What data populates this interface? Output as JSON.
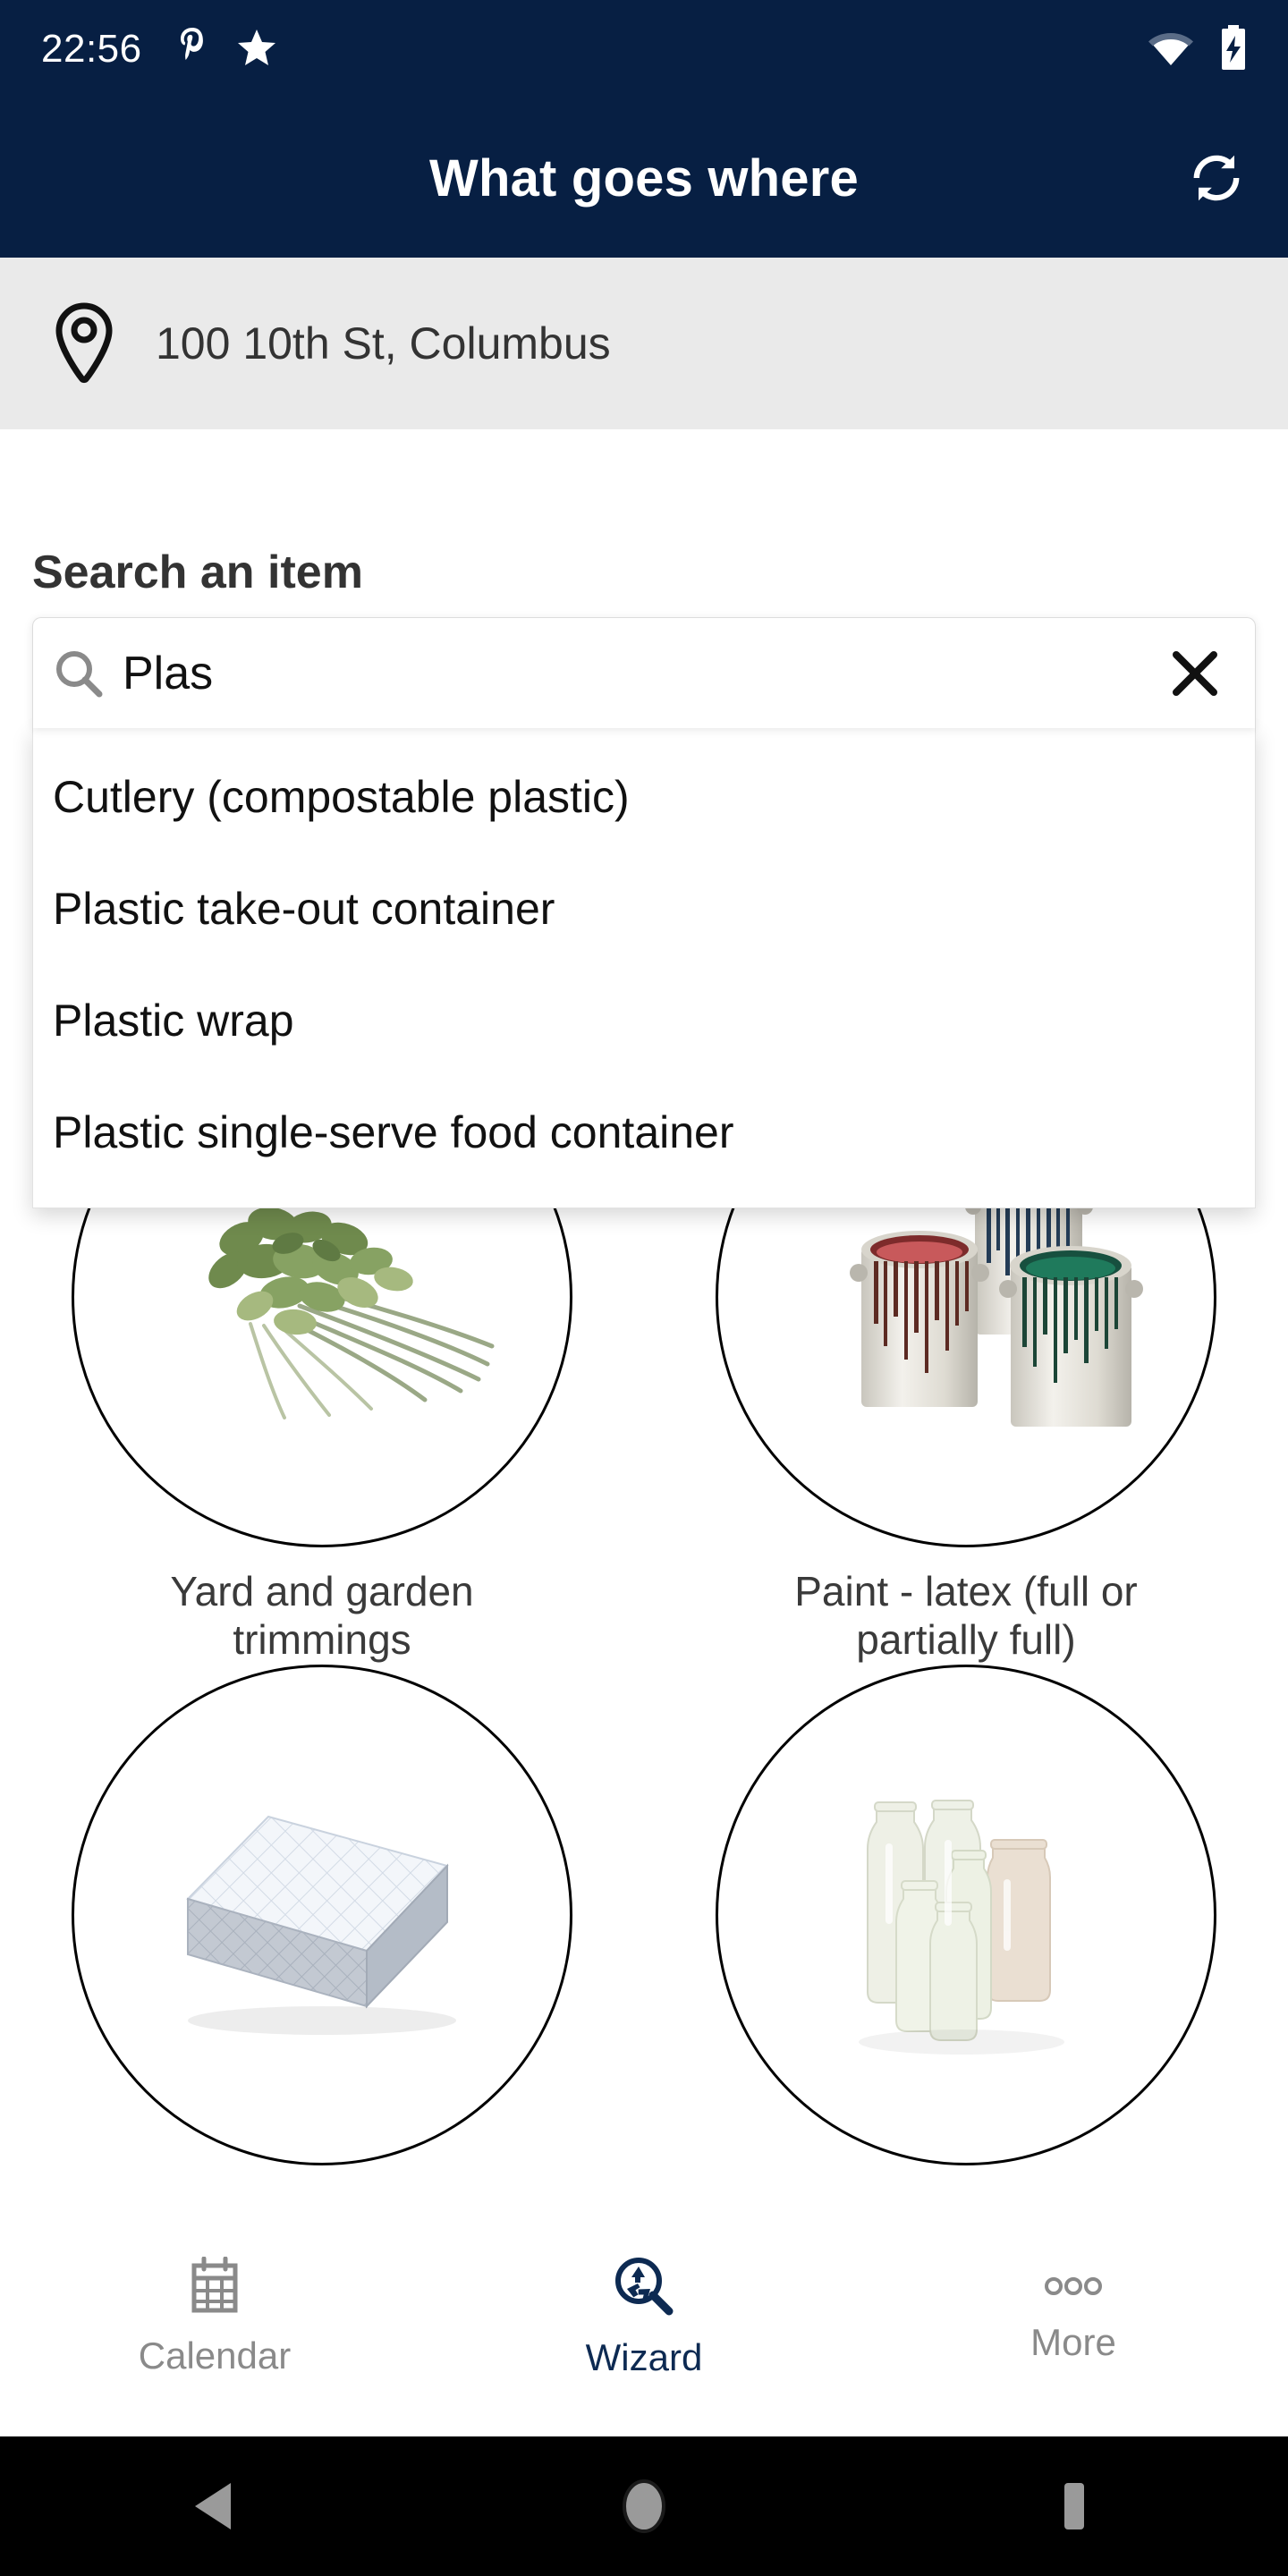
{
  "status_bar": {
    "time": "22:56",
    "left_icons": [
      "pinterest-p-icon",
      "star-icon"
    ],
    "right_icons": [
      "wifi-icon",
      "battery-charging-icon"
    ]
  },
  "app_bar": {
    "title": "What goes where",
    "action_icon": "refresh-sync-icon",
    "background_color": "#071f43",
    "title_color": "#ffffff"
  },
  "location_bar": {
    "icon": "location-pin-icon",
    "address": "100 10th St, Columbus",
    "background_color": "#eaeaea"
  },
  "search": {
    "label": "Search an item",
    "value": "Plas",
    "placeholder": "Search an item",
    "search_icon": "magnifier-icon",
    "clear_icon": "close-x-icon",
    "suggestions": [
      "Cutlery (compostable plastic)",
      "Plastic take-out container",
      "Plastic wrap",
      "Plastic single-serve food container"
    ]
  },
  "items": [
    {
      "label": "Yard and garden trimmings",
      "image": "yard-trimmings-photo"
    },
    {
      "label": "Paint - latex (full or partially full)",
      "image": "paint-cans-photo"
    },
    {
      "label": "",
      "image": "mattress-photo"
    },
    {
      "label": "",
      "image": "glass-jars-photo"
    }
  ],
  "bottom_nav": {
    "items": [
      {
        "label": "Calendar",
        "icon": "calendar-icon",
        "active": false
      },
      {
        "label": "Wizard",
        "icon": "recycle-magnifier-icon",
        "active": true
      },
      {
        "label": "More",
        "icon": "more-dots-icon",
        "active": false
      }
    ],
    "active_color": "#0d2a52",
    "inactive_color": "#8a8a8a"
  },
  "system_nav": {
    "back_icon": "back-triangle-icon",
    "home_icon": "home-circle-icon",
    "recents_icon": "recents-square-icon"
  }
}
